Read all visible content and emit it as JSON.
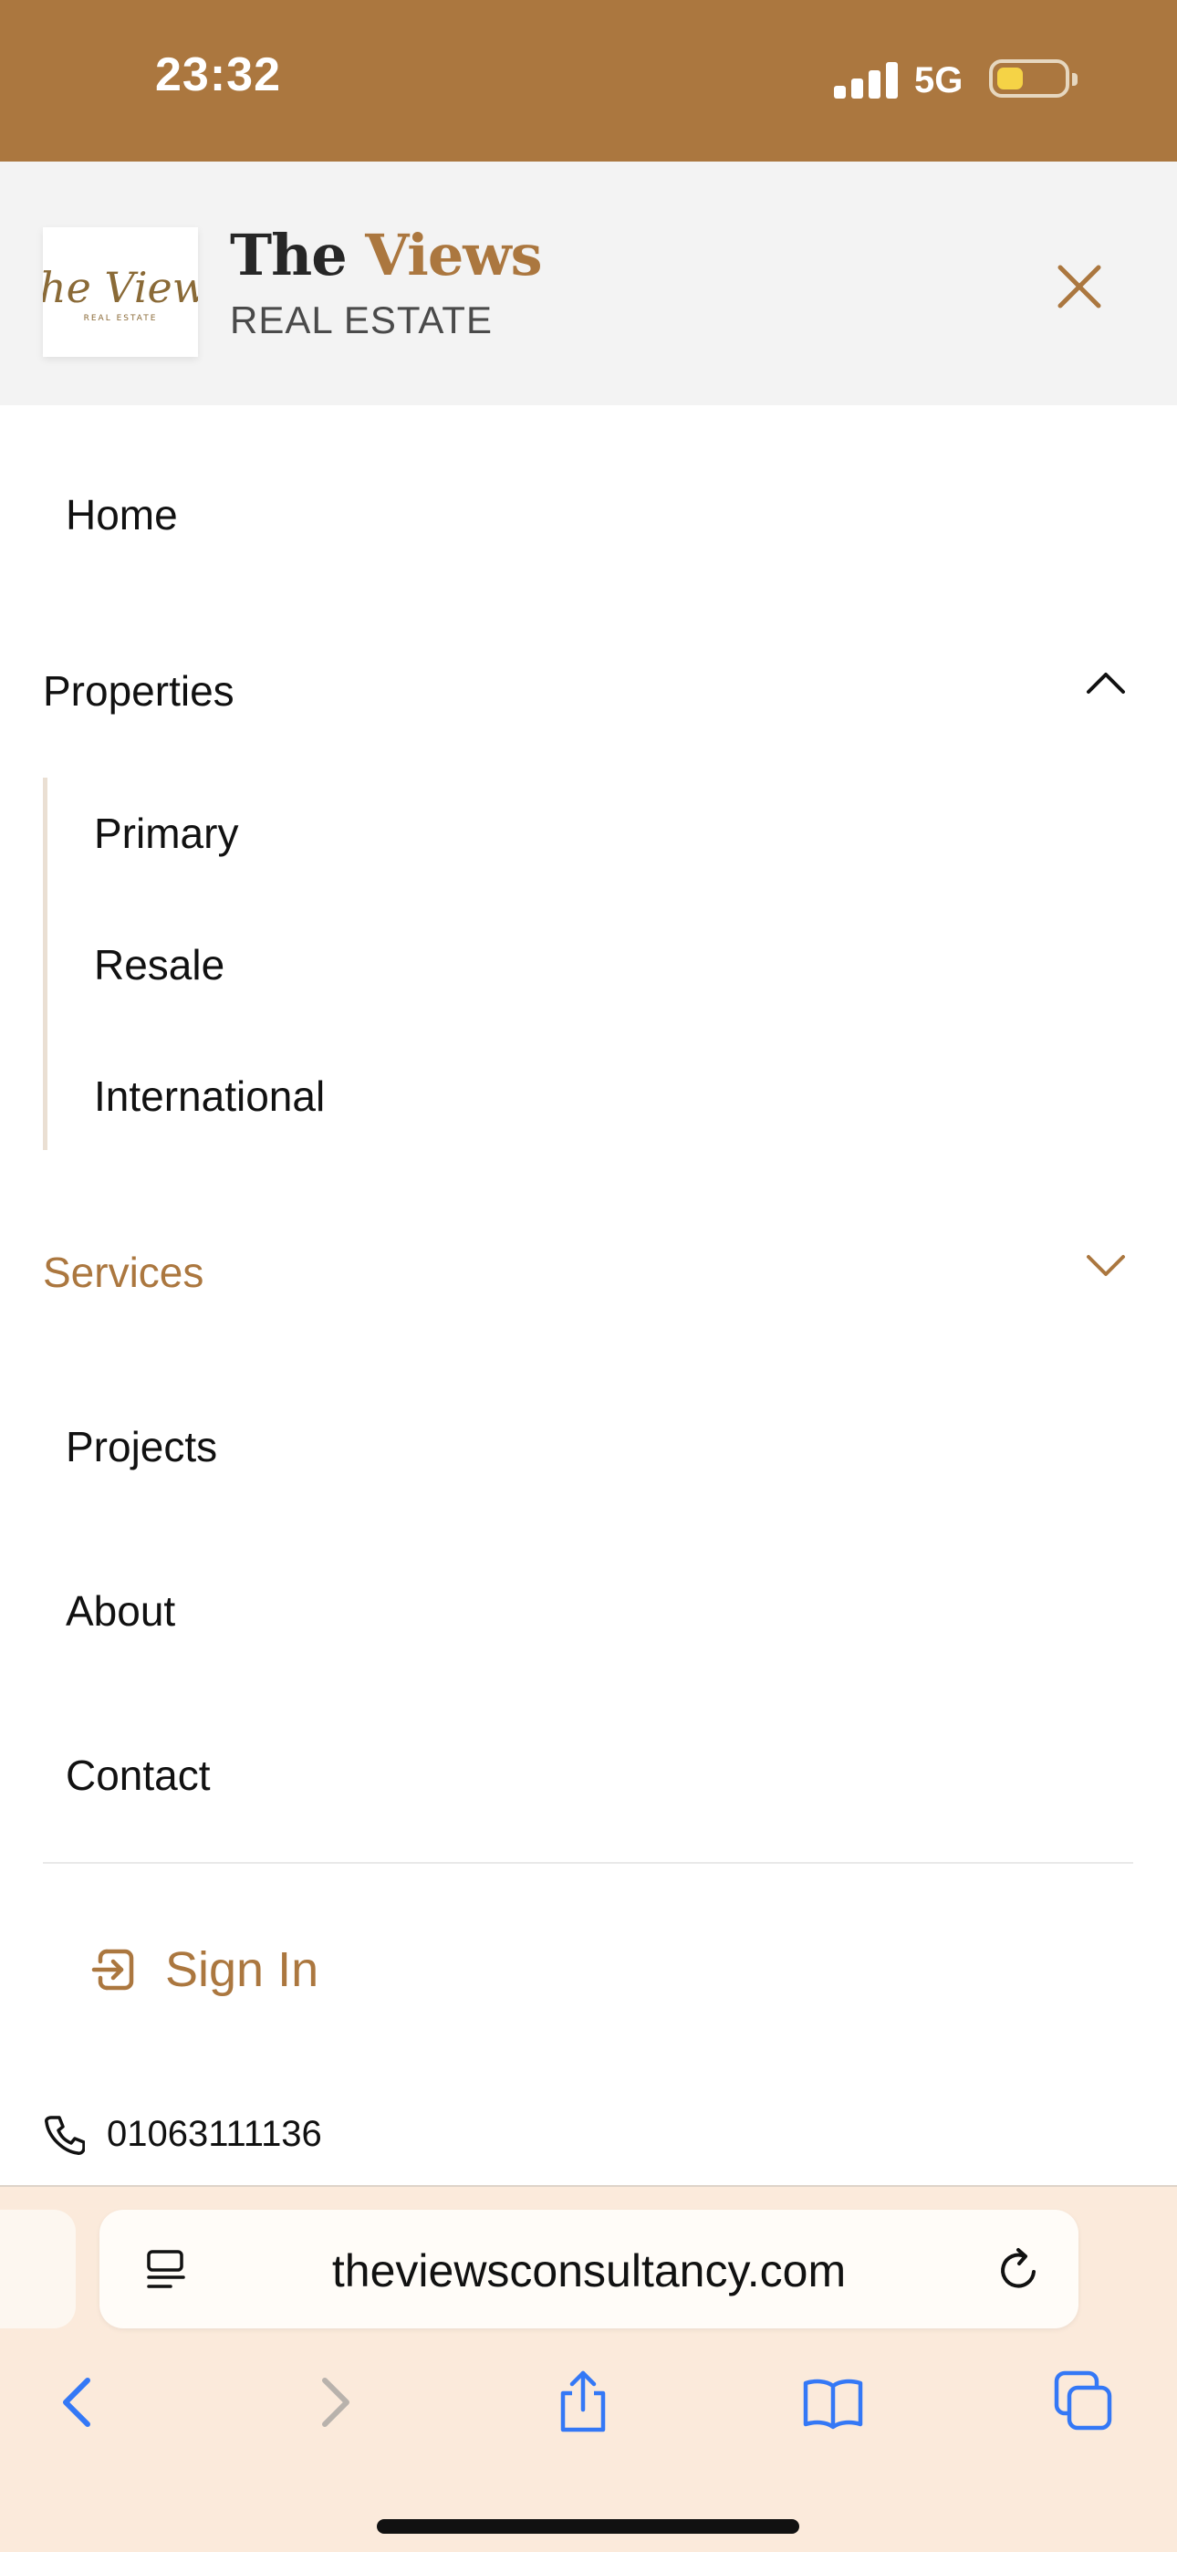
{
  "status_bar": {
    "time": "23:32",
    "network": "5G",
    "battery_level": 0.35,
    "icons": [
      "signal-icon",
      "battery-icon"
    ]
  },
  "header": {
    "logo_text": "The Views",
    "logo_subtext": "REAL ESTATE",
    "brand_title_part1": "The",
    "brand_title_part2": "Views",
    "brand_subtitle": "REAL ESTATE",
    "close_icon": "close-icon"
  },
  "menu": {
    "home": "Home",
    "properties": {
      "label": "Properties",
      "expanded": true,
      "children": [
        "Primary",
        "Resale",
        "International"
      ]
    },
    "services": {
      "label": "Services",
      "expanded": false
    },
    "projects": "Projects",
    "about": "About",
    "contact": "Contact",
    "sign_in": "Sign In",
    "phone": "01063111136"
  },
  "browser": {
    "url": "theviewsconsultancy.com",
    "icons": [
      "reader-icon",
      "reload-icon",
      "back-icon",
      "forward-icon",
      "share-icon",
      "bookmarks-icon",
      "tabs-icon"
    ]
  },
  "colors": {
    "accent": "#ab773f",
    "status_bar_bg": "#ab773f",
    "header_bg": "#f3f3f3",
    "browser_bar_bg": "#fbeadb",
    "safari_blue": "#3478f6"
  }
}
